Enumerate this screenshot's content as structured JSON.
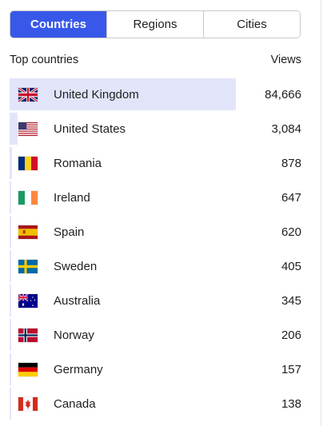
{
  "tabs": [
    {
      "label": "Countries",
      "active": true
    },
    {
      "label": "Regions",
      "active": false
    },
    {
      "label": "Cities",
      "active": false
    }
  ],
  "table": {
    "column_label": "Top countries",
    "views_label": "Views",
    "accent_color": "#3858e9",
    "bar_color": "#e2e5fa",
    "rows": [
      {
        "flag": "flag-gb-icon",
        "country": "United Kingdom",
        "views": "84,666",
        "share": 1.0
      },
      {
        "flag": "flag-us-icon",
        "country": "United States",
        "views": "3,084",
        "share": 0.036
      },
      {
        "flag": "flag-ro-icon",
        "country": "Romania",
        "views": "878",
        "share": 0.0104
      },
      {
        "flag": "flag-ie-icon",
        "country": "Ireland",
        "views": "647",
        "share": 0.0076
      },
      {
        "flag": "flag-es-icon",
        "country": "Spain",
        "views": "620",
        "share": 0.0073
      },
      {
        "flag": "flag-se-icon",
        "country": "Sweden",
        "views": "405",
        "share": 0.0048
      },
      {
        "flag": "flag-au-icon",
        "country": "Australia",
        "views": "345",
        "share": 0.0041
      },
      {
        "flag": "flag-no-icon",
        "country": "Norway",
        "views": "206",
        "share": 0.0024
      },
      {
        "flag": "flag-de-icon",
        "country": "Germany",
        "views": "157",
        "share": 0.0019
      },
      {
        "flag": "flag-ca-icon",
        "country": "Canada",
        "views": "138",
        "share": 0.0016
      }
    ]
  }
}
